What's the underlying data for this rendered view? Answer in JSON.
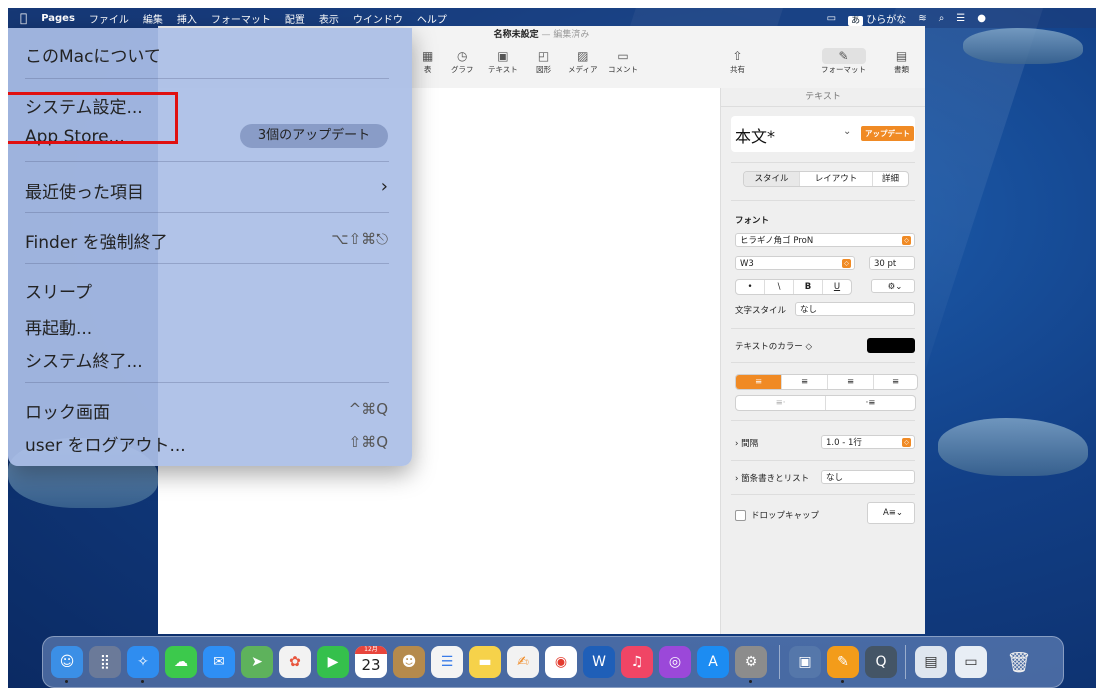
{
  "menubar": {
    "apple": "",
    "items": [
      "Pages",
      "ファイル",
      "編集",
      "挿入",
      "フォーマット",
      "配置",
      "表示",
      "ウインドウ",
      "ヘルプ"
    ],
    "ime_badge": "あ",
    "ime_label": "ひらがな"
  },
  "window": {
    "title": "名称未設定",
    "separator": "—",
    "status": "編集済み",
    "toolbar": [
      "表",
      "グラフ",
      "テキスト",
      "図形",
      "メディア",
      "コメント",
      "共有",
      "フォーマット",
      "書類"
    ]
  },
  "sidebar": {
    "header": "テキスト",
    "style_name": "本文*",
    "update_badge": "アップデート",
    "tabs": [
      "スタイル",
      "レイアウト",
      "詳細"
    ],
    "font_label": "フォント",
    "font_name": "ヒラギノ角ゴ ProN",
    "font_weight": "W3",
    "font_size": "30 pt",
    "format_buttons": [
      "•",
      "\\",
      "B",
      "U"
    ],
    "text_style_label": "文字スタイル",
    "text_style_value": "なし",
    "text_color_label": "テキストのカラー ◇",
    "spacing_label": "間隔",
    "spacing_value": "1.0 - 1行",
    "list_label": "箇条書きとリスト",
    "list_value": "なし",
    "dropcap_label": "ドロップキャップ"
  },
  "apple_menu": {
    "items": [
      "このMacについて",
      "システム設定...",
      "App Store...",
      "最近使った項目",
      "Finder を強制終了",
      "スリープ",
      "再起動...",
      "システム終了...",
      "ロック画面",
      "user をログアウト..."
    ],
    "updates_badge": "3個のアップデート",
    "shortcuts": {
      "force_quit": "⌥⇧⌘⎋",
      "lock": "^⌘Q",
      "logout": "⇧⌘Q",
      "recent_arrow": "›"
    }
  },
  "dock": {
    "calendar_month": "12月",
    "calendar_day": "23"
  },
  "colors": {
    "accent": "#f08a24",
    "highlight": "#e01010",
    "desktop": "#123f86"
  }
}
